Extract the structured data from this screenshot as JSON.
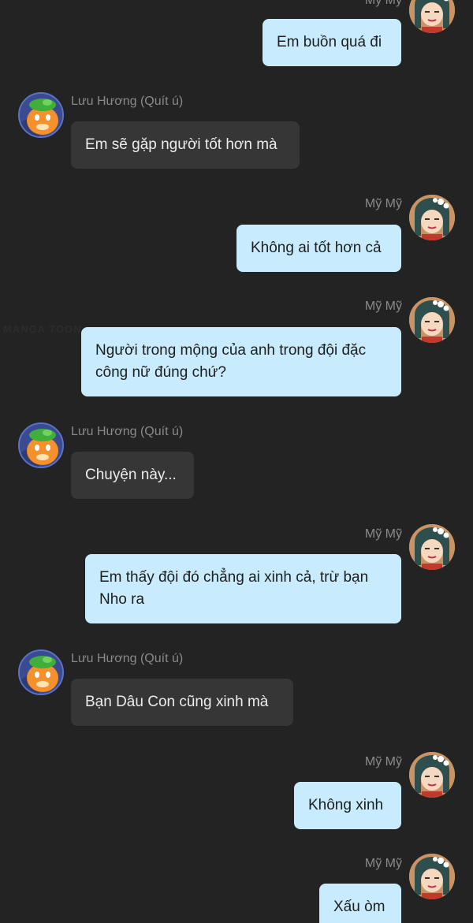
{
  "watermark": "MANGA TOON",
  "contacts": {
    "left_name": "Lưu Hương (Quít ú)",
    "right_name": "Mỹ Mỹ"
  },
  "messages": [
    {
      "sender": "Mỹ Mỹ",
      "side": "right",
      "text": "Em buồn quá đi"
    },
    {
      "sender": "Lưu Hương (Quít ú)",
      "side": "left",
      "text": "Em sẽ gặp người tốt hơn mà"
    },
    {
      "sender": "Mỹ Mỹ",
      "side": "right",
      "text": "Không ai tốt hơn cả"
    },
    {
      "sender": "Mỹ Mỹ",
      "side": "right",
      "text": "Người trong mộng của anh trong đội đặc công nữ đúng chứ?"
    },
    {
      "sender": "Lưu Hương (Quít ú)",
      "side": "left",
      "text": "Chuyện này..."
    },
    {
      "sender": "Mỹ Mỹ",
      "side": "right",
      "text": "Em thấy đội đó chẳng ai xinh cả, trừ bạn Nho ra"
    },
    {
      "sender": "Lưu Hương (Quít ú)",
      "side": "left",
      "text": "Bạn Dâu Con cũng xinh mà"
    },
    {
      "sender": "Mỹ Mỹ",
      "side": "right",
      "text": "Không xinh"
    },
    {
      "sender": "Mỹ Mỹ",
      "side": "right",
      "text": "Xấu òm"
    }
  ],
  "colors": {
    "background": "#232323",
    "left_bubble": "#363636",
    "right_bubble": "#c8ecfd"
  },
  "icons": {
    "left_avatar": "orange-character-avatar",
    "right_avatar": "girl-character-avatar"
  }
}
